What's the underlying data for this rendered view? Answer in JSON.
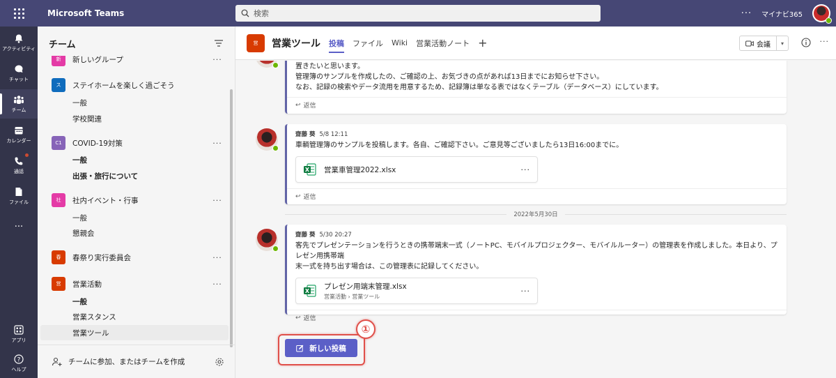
{
  "app": {
    "title": "Microsoft Teams",
    "search_placeholder": "検索",
    "more": "···",
    "org": "マイナビ365"
  },
  "rail": [
    {
      "label": "アクティビティ",
      "icon": "bell-icon"
    },
    {
      "label": "チャット",
      "icon": "chat-icon"
    },
    {
      "label": "チーム",
      "icon": "teams-icon",
      "active": true
    },
    {
      "label": "カレンダー",
      "icon": "calendar-icon"
    },
    {
      "label": "通話",
      "icon": "phone-icon",
      "badge": true
    },
    {
      "label": "ファイル",
      "icon": "file-icon"
    },
    {
      "label": "···",
      "icon": "more-icon"
    },
    {
      "label": "アプリ",
      "icon": "apps-icon"
    },
    {
      "label": "ヘルプ",
      "icon": "help-icon"
    }
  ],
  "teams_pane": {
    "title": "チーム",
    "teams": [
      {
        "name": "新しいグループ",
        "avatar": "新",
        "color": "#e43ba6"
      },
      {
        "name": "ステイホームを楽しく過ごそう",
        "avatar": "ス",
        "color": "#0f6cbd"
      },
      {
        "name": "COVID-19対策",
        "avatar": "C1",
        "color": "#8764b8"
      },
      {
        "name": "社内イベント・行事",
        "avatar": "社",
        "color": "#e43ba6"
      },
      {
        "name": "春祭り実行委員会",
        "avatar": "春",
        "color": "#d83b01"
      },
      {
        "name": "営業活動",
        "avatar": "営",
        "color": "#d83b01"
      }
    ],
    "channels": {
      "stay": [
        "一般",
        "学校関連"
      ],
      "covid": [
        "一般",
        "出張・旅行について"
      ],
      "event": [
        "一般",
        "懇親会"
      ],
      "sales": [
        "一般",
        "営業スタンス",
        "営業ツール"
      ]
    },
    "more": "···",
    "footer": "チームに参加、またはチームを作成"
  },
  "channel": {
    "avatar": "営",
    "title": "営業ツール",
    "tabs": [
      "投稿",
      "ファイル",
      "Wiki",
      "営業活動ノート"
    ],
    "plus": "+",
    "meet": "会議",
    "more": "···"
  },
  "posts": [
    {
      "lines": [
        "置きたいと思います。",
        "管理簿のサンプルを作成したの、ご確認の上、お気づきの点があれば13日までにお知らせ下さい。",
        "なお、記録の検索やデータ流用を用意するため、記録簿は単なる表ではなくテーブル（データベース）にしています。"
      ],
      "reply": "返信"
    },
    {
      "author": "齋藤 葵",
      "time": "5/8 12:11",
      "text": "車輌管理簿のサンプルを投稿します。各自、ご確認下さい。ご意見等ございましたら13日16:00までに。",
      "file": "営業車管理2022.xlsx",
      "reply": "返信"
    },
    {
      "author": "齋藤 葵",
      "time": "5/30 20:27",
      "lines": [
        "客先でプレゼンテーションを行うときの携帯端末一式（ノートPC、モバイルプロジェクター、モバイルルーター）の管理表を作成しました。本日より、プレゼン用携帯端",
        "末一式を持ち出す場合は、この管理表に記録してください。"
      ],
      "file": "プレゼン用端末管理.xlsx",
      "file_path": "営業活動 › 営業ツール",
      "reply": "返信"
    }
  ],
  "date_divider": "2022年5月30日",
  "new_post": "新しい投稿",
  "step_marker": "①",
  "colors": {
    "topbar": "#464775",
    "rail": "#33344a",
    "accent": "#5b5fc7",
    "highlight": "#e0504a"
  }
}
